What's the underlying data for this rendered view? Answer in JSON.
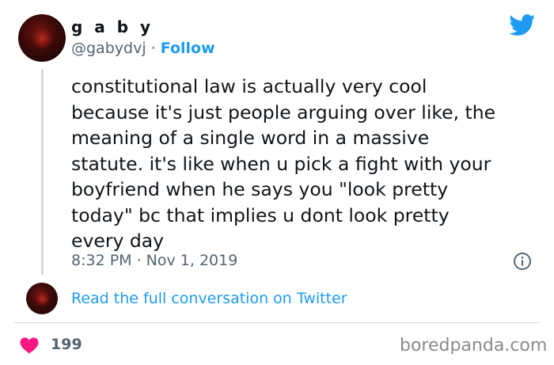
{
  "author": {
    "display_name": "g a b y",
    "handle": "@gabydvj",
    "separator": "·",
    "follow_label": "Follow"
  },
  "tweet": {
    "lines": [
      "constitutional law is actually very cool",
      "because it's just people arguing over like, the",
      "meaning of a single word in a massive",
      "statute. it's like when u pick a fight with your",
      "boyfriend when he says you \"look pretty",
      "today\" bc that implies u dont look pretty",
      "every day"
    ],
    "timestamp": "8:32 PM · Nov 1, 2019"
  },
  "conversation": {
    "read_link_label": "Read the full conversation on Twitter"
  },
  "engagement": {
    "likes": "199"
  },
  "watermark": "boredpanda.com",
  "colors": {
    "accent": "#1d9bf0",
    "heart": "#f91880",
    "secondary_text": "#536471"
  },
  "icons": [
    "twitter-bird-icon",
    "info-icon",
    "heart-icon"
  ]
}
